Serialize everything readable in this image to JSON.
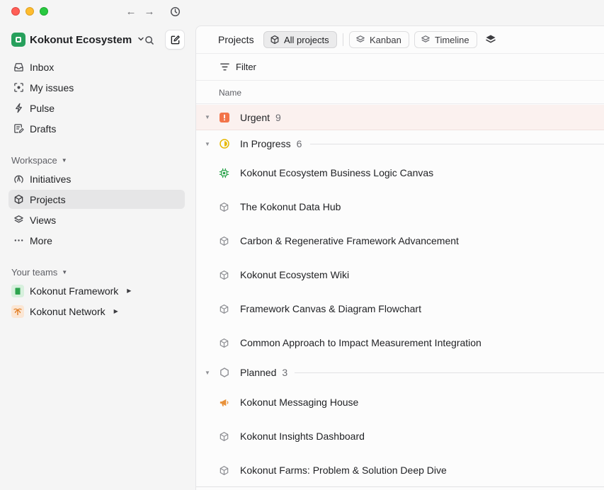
{
  "workspace": {
    "name": "Kokonut Ecosystem"
  },
  "sidebar": {
    "main_items": [
      {
        "label": "Inbox",
        "icon": "inbox-icon"
      },
      {
        "label": "My issues",
        "icon": "my-issues-icon"
      },
      {
        "label": "Pulse",
        "icon": "pulse-icon"
      },
      {
        "label": "Drafts",
        "icon": "drafts-icon"
      }
    ],
    "workspace_label": "Workspace",
    "workspace_items": [
      {
        "label": "Initiatives",
        "icon": "initiatives-icon"
      },
      {
        "label": "Projects",
        "icon": "projects-icon",
        "active": true
      },
      {
        "label": "Views",
        "icon": "views-icon"
      },
      {
        "label": "More",
        "icon": "more-icon"
      }
    ],
    "teams_label": "Your teams",
    "teams": [
      {
        "label": "Kokonut Framework",
        "icon": "book-icon",
        "color": "#2da44e"
      },
      {
        "label": "Kokonut Network",
        "icon": "palm-tree-icon",
        "color": "#e07b1f"
      }
    ]
  },
  "topbar": {
    "title": "Projects",
    "views": [
      {
        "label": "All projects",
        "icon": "cube-icon",
        "active": true
      },
      {
        "label": "Kanban",
        "icon": "layers-icon"
      },
      {
        "label": "Timeline",
        "icon": "layers-icon"
      }
    ]
  },
  "filter": {
    "label": "Filter"
  },
  "columns": {
    "name": "Name"
  },
  "groups": [
    {
      "label": "Urgent",
      "count": "9",
      "icon": "urgent-icon",
      "color": "#f2744a",
      "projects": []
    },
    {
      "label": "In Progress",
      "count": "6",
      "icon": "in-progress-icon",
      "color": "#e6b800",
      "projects": [
        {
          "name": "Kokonut Ecosystem Business Logic Canvas",
          "icon": "chip-icon",
          "color": "#2da44e"
        },
        {
          "name": "The Kokonut Data Hub",
          "icon": "cube-icon",
          "color": "#8e8f94"
        },
        {
          "name": "Carbon & Regenerative Framework Advancement",
          "icon": "cube-icon",
          "color": "#8e8f94"
        },
        {
          "name": "Kokonut Ecosystem Wiki",
          "icon": "cube-icon",
          "color": "#8e8f94"
        },
        {
          "name": "Framework Canvas & Diagram Flowchart",
          "icon": "cube-icon",
          "color": "#8e8f94"
        },
        {
          "name": "Common Approach to Impact Measurement Integration",
          "icon": "cube-icon",
          "color": "#8e8f94"
        }
      ]
    },
    {
      "label": "Planned",
      "count": "3",
      "icon": "planned-icon",
      "color": "#8e8f94",
      "projects": [
        {
          "name": "Kokonut Messaging House",
          "icon": "megaphone-icon",
          "color": "#e8913a"
        },
        {
          "name": "Kokonut Insights Dashboard",
          "icon": "cube-icon",
          "color": "#8e8f94"
        },
        {
          "name": "Kokonut Farms: Problem & Solution Deep Dive",
          "icon": "cube-icon",
          "color": "#8e8f94"
        }
      ]
    }
  ]
}
